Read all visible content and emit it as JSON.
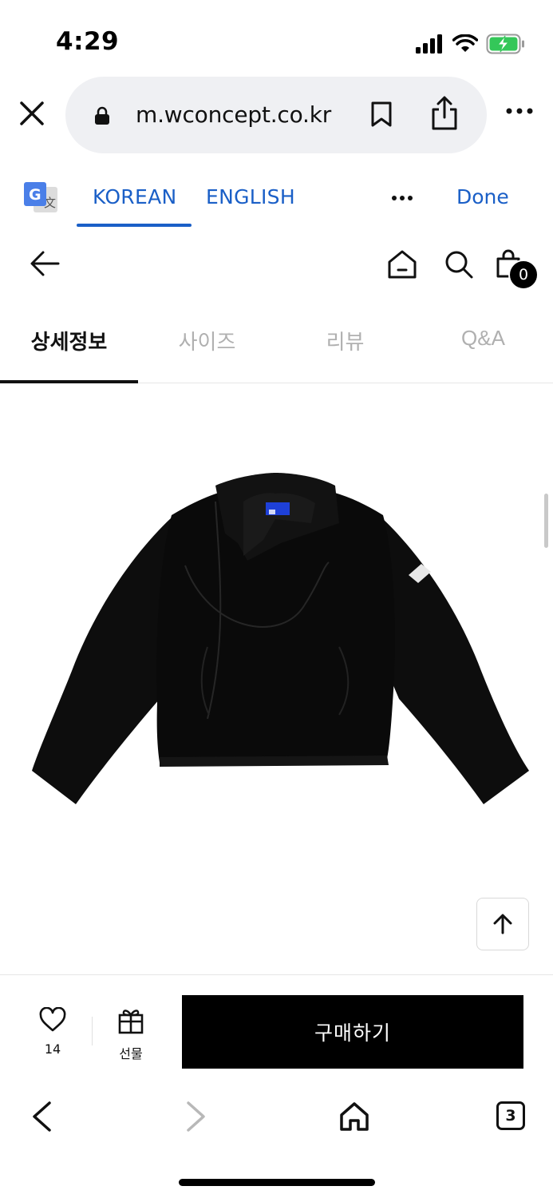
{
  "status": {
    "time": "4:29"
  },
  "browser": {
    "url": "m.wconcept.co.kr"
  },
  "translate": {
    "tabs": [
      "KOREAN",
      "ENGLISH"
    ],
    "done_label": "Done"
  },
  "header": {
    "cart_count": "0"
  },
  "product_tabs": [
    "상세정보",
    "사이즈",
    "리뷰",
    "Q&A"
  ],
  "product": {
    "image_alt": "black cropped jacket"
  },
  "purchase": {
    "like_count": "14",
    "gift_label": "선물",
    "buy_label": "구매하기"
  },
  "toolbar": {
    "tab_count": "3"
  },
  "colors": {
    "translate_blue": "#1a5fc7",
    "battery_green": "#34c759",
    "buy_button": "#000000"
  }
}
